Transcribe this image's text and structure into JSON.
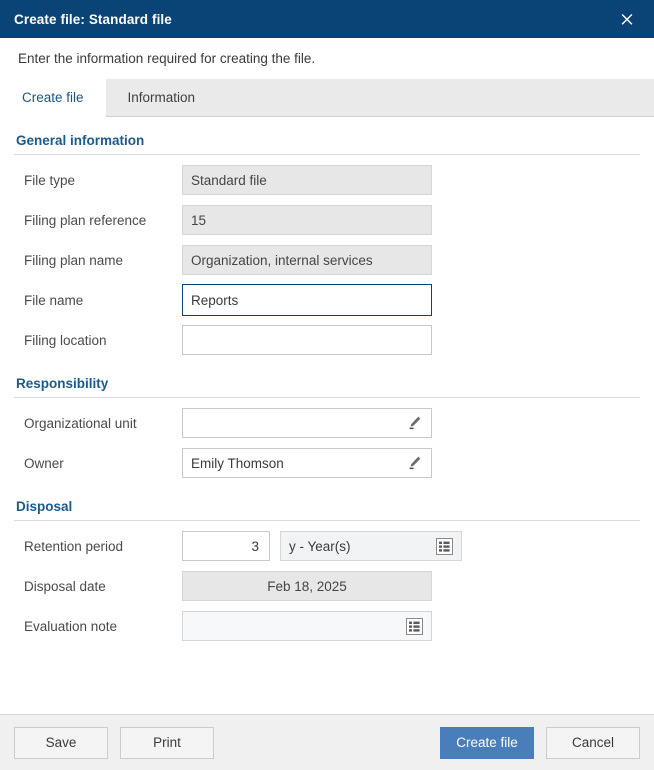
{
  "dialog": {
    "title": "Create file: Standard file",
    "close_icon": "close-icon",
    "description": "Enter the information required for creating the file."
  },
  "tabs": [
    {
      "label": "Create file",
      "active": true
    },
    {
      "label": "Information",
      "active": false
    }
  ],
  "sections": {
    "general": {
      "title": "General information",
      "fields": {
        "file_type": {
          "label": "File type",
          "value": "Standard file"
        },
        "filing_plan_reference": {
          "label": "Filing plan reference",
          "value": "15"
        },
        "filing_plan_name": {
          "label": "Filing plan name",
          "value": "Organization, internal services"
        },
        "file_name": {
          "label": "File name",
          "value": "Reports"
        },
        "filing_location": {
          "label": "Filing location",
          "value": ""
        }
      }
    },
    "responsibility": {
      "title": "Responsibility",
      "fields": {
        "organizational_unit": {
          "label": "Organizational unit",
          "value": "",
          "icon": "pencil-icon"
        },
        "owner": {
          "label": "Owner",
          "value": "Emily Thomson",
          "icon": "pencil-icon"
        }
      }
    },
    "disposal": {
      "title": "Disposal",
      "fields": {
        "retention_period": {
          "label": "Retention period",
          "value": "3",
          "unit_value": "y - Year(s)",
          "unit_icon": "list-icon"
        },
        "disposal_date": {
          "label": "Disposal date",
          "value": "Feb 18, 2025"
        },
        "evaluation_note": {
          "label": "Evaluation note",
          "value": "",
          "icon": "list-icon"
        }
      }
    }
  },
  "footer": {
    "save_label": "Save",
    "print_label": "Print",
    "create_label": "Create file",
    "cancel_label": "Cancel"
  },
  "colors": {
    "titlebar": "#0a4476",
    "primary_button": "#4a7ebb",
    "section_heading": "#1b5a8e",
    "focus_border": "#0a4476"
  }
}
